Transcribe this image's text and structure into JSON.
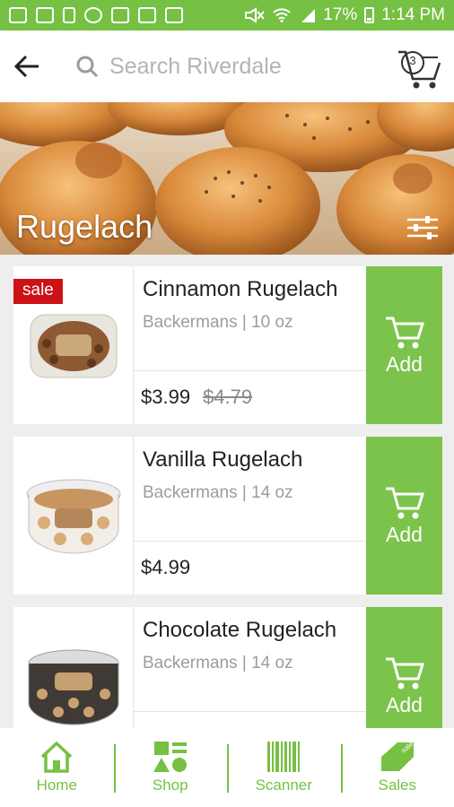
{
  "status_bar": {
    "battery": "17%",
    "time": "1:14 PM",
    "icons": [
      "message-icon",
      "tablet-icon",
      "bag-icon",
      "maps-icon",
      "gallery-icon",
      "photo-icon",
      "calendar-icon",
      "mute-icon",
      "wifi-icon",
      "signal-icon",
      "battery-icon"
    ]
  },
  "header": {
    "back_icon": "arrow-left-icon",
    "search_icon": "search-icon",
    "search_placeholder": "Search Riverdale",
    "search_value": "",
    "cart_icon": "cart-icon",
    "cart_count": "3"
  },
  "hero": {
    "title": "Rugelach",
    "filter_icon": "sliders-icon"
  },
  "products": [
    {
      "name": "Cinnamon Rugelach",
      "brand": "Backermans",
      "size": "10 oz",
      "meta": "Backermans | 10 oz",
      "price": "$3.99",
      "old_price": "$4.79",
      "sale_badge": "sale",
      "add_label": "Add"
    },
    {
      "name": "Vanilla Rugelach",
      "brand": "Backermans",
      "size": "14 oz",
      "meta": "Backermans | 14 oz",
      "price": "$4.99",
      "old_price": "",
      "sale_badge": "",
      "add_label": "Add"
    },
    {
      "name": "Chocolate Rugelach",
      "brand": "Backermans",
      "size": "14 oz",
      "meta": "Backermans | 14 oz",
      "price": "",
      "old_price": "",
      "sale_badge": "",
      "add_label": "Add"
    }
  ],
  "bottom_nav": [
    {
      "label": "Home",
      "icon": "home-icon"
    },
    {
      "label": "Shop",
      "icon": "shapes-icon"
    },
    {
      "label": "Scanner",
      "icon": "barcode-icon"
    },
    {
      "label": "Sales",
      "icon": "sale-tag-icon",
      "icon_text": "sale"
    }
  ],
  "colors": {
    "brand_green": "#76c043",
    "add_green": "#7bc34a",
    "sale_red": "#cc1216"
  }
}
